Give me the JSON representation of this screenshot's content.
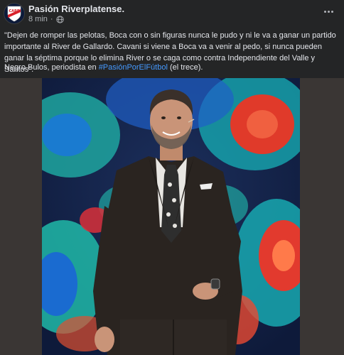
{
  "post": {
    "author": "Pasión Riverplatense.",
    "time": "8 min",
    "menu_icon": "more-horizontal-icon",
    "avatar_icon": "river-plate-crest",
    "text": "\"Dejen de romper las pelotas, Boca con o sin figuras nunca le pudo y ni le va a ganar un partido importante al River de Gallardo. Cavani si viene a Boca va a venir al pedo, si nunca pueden ganar la séptima porque lo elimina River o se caga como contra Independiente del Valle y Santos\".",
    "caption_prefix": "Negro Bulos, periodista en ",
    "hashtag": "#PasiónPorElFútbol",
    "caption_suffix": " (el trece)."
  },
  "colors": {
    "background": "#242526",
    "text": "#e4e6eb",
    "secondary_text": "#b0b3b8",
    "hashtag": "#4599ff",
    "river_red": "#d8202a"
  }
}
